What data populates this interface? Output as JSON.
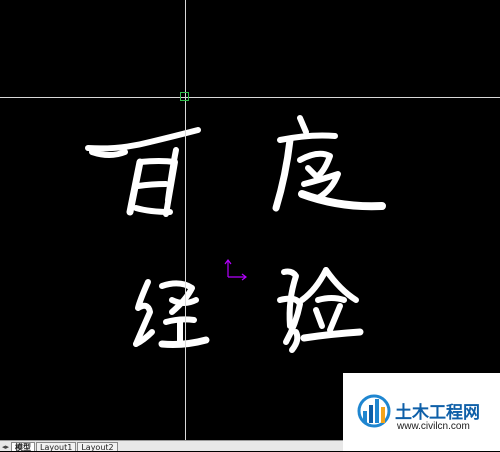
{
  "drawing": {
    "characters": [
      "百",
      "度",
      "经",
      "验"
    ]
  },
  "tabs": {
    "nav": "◂▸",
    "model": "模型",
    "layout1": "Layout1",
    "layout2": "Layout2"
  },
  "watermark": {
    "title": "土木工程网",
    "url": "www.civilcn.com"
  },
  "colors": {
    "background": "#000000",
    "crosshair": "#d8d8d8",
    "pickbox": "#2fbf4a",
    "ucs": "#b400ff",
    "watermark_blue": "#0e5fa8"
  },
  "icons": {
    "ucs": "ucs-icon",
    "logo": "civilcn-logo"
  }
}
